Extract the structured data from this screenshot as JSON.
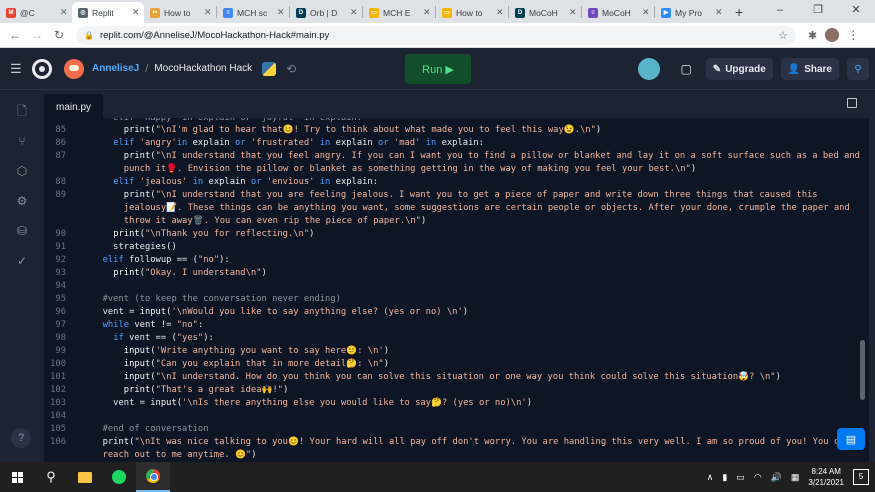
{
  "browser": {
    "tabs": [
      {
        "label": "@C",
        "icon": "gmail-icon",
        "color": "#ea4335"
      },
      {
        "label": "Replit",
        "icon": "replit-icon",
        "color": "#56676e",
        "active": true
      },
      {
        "label": "How to",
        "icon": "tools-icon",
        "color": "#e8a23a"
      },
      {
        "label": "MCH sc",
        "icon": "docs-icon",
        "color": "#4285f4"
      },
      {
        "label": "Orb | D",
        "icon": "devpost-icon",
        "color": "#003e54"
      },
      {
        "label": "MCH E",
        "icon": "slides-icon",
        "color": "#f4b400"
      },
      {
        "label": "How to",
        "icon": "slides-icon",
        "color": "#f4b400"
      },
      {
        "label": "MoCoH",
        "icon": "devpost-icon",
        "color": "#003e54"
      },
      {
        "label": "MoCoH",
        "icon": "forms-icon",
        "color": "#7248b9"
      },
      {
        "label": "My Pro",
        "icon": "zoom-icon",
        "color": "#2d8cff"
      }
    ],
    "new_tab": "+",
    "url": "replit.com/@AnneliseJ/MocoHackathon-Hack#main.py"
  },
  "header": {
    "username": "AnneliseJ",
    "separator": "/",
    "repl_name": "MocoHackathon Hack",
    "run_label": "Run ▶",
    "upgrade_label": "Upgrade",
    "share_label": "Share"
  },
  "editor": {
    "file_tab": "main.py",
    "accent": "#0e1525"
  },
  "taskbar": {
    "time": "8:24 AM",
    "date": "3/21/2021",
    "notifications": "5"
  }
}
